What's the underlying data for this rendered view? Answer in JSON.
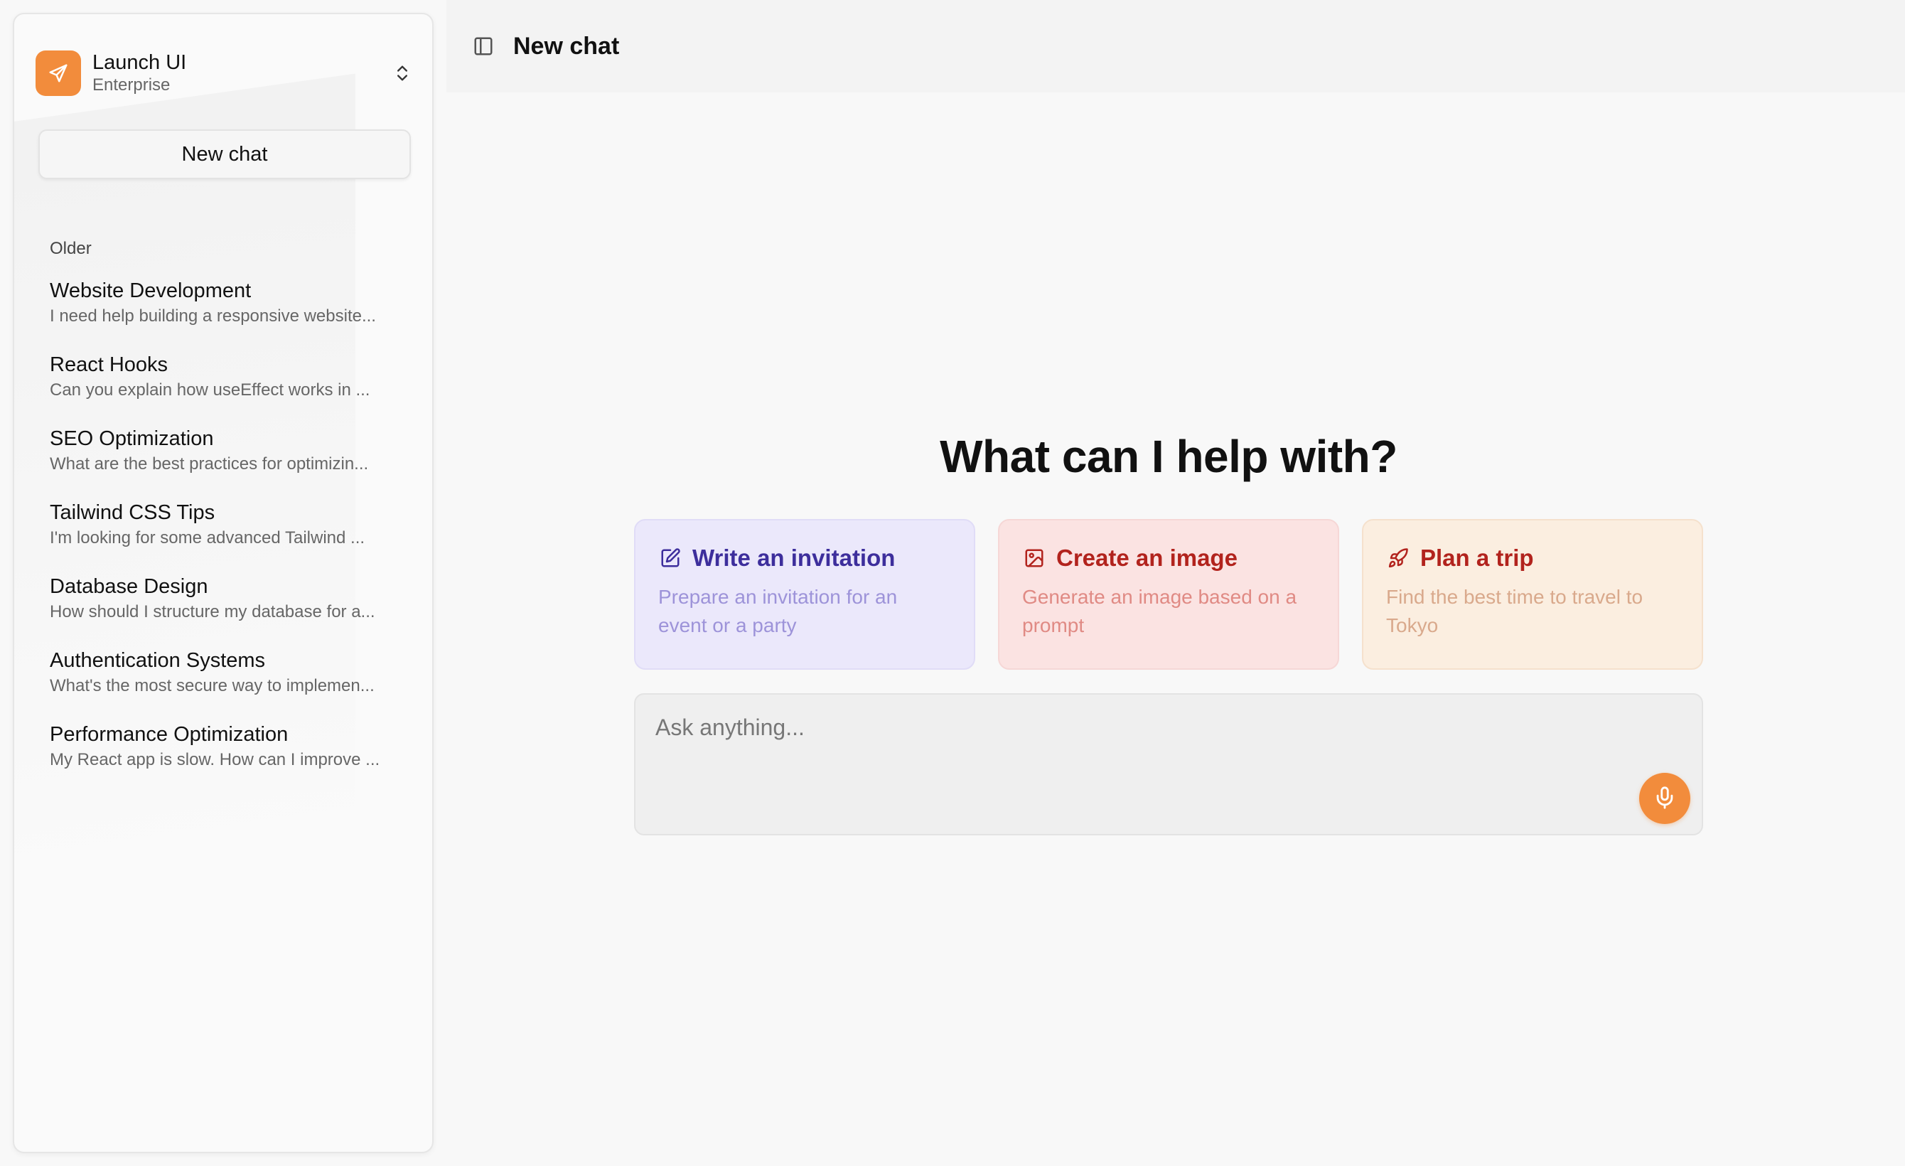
{
  "sidebar": {
    "team": {
      "name": "Launch UI",
      "plan": "Enterprise",
      "logo_icon": "paper-plane-icon",
      "switcher_icon": "chevrons-up-down-icon"
    },
    "new_chat_label": "New chat",
    "group_label": "Older",
    "items": [
      {
        "title": "Website Development",
        "preview": "I need help building a responsive website..."
      },
      {
        "title": "React Hooks",
        "preview": "Can you explain how useEffect works in ..."
      },
      {
        "title": "SEO Optimization",
        "preview": "What are the best practices for optimizin..."
      },
      {
        "title": "Tailwind CSS Tips",
        "preview": "I'm looking for some advanced Tailwind ..."
      },
      {
        "title": "Database Design",
        "preview": "How should I structure my database for a..."
      },
      {
        "title": "Authentication Systems",
        "preview": "What's the most secure way to implemen..."
      },
      {
        "title": "Performance Optimization",
        "preview": "My React app is slow. How can I improve ..."
      }
    ]
  },
  "header": {
    "toggle_icon": "panel-left-icon",
    "title": "New chat"
  },
  "main": {
    "heading": "What can I help with?",
    "suggestions": [
      {
        "icon": "edit-icon",
        "title": "Write an invitation",
        "description": "Prepare an invitation for an event or a party"
      },
      {
        "icon": "image-icon",
        "title": "Create an image",
        "description": "Generate an image based on a prompt"
      },
      {
        "icon": "rocket-icon",
        "title": "Plan a trip",
        "description": "Find the best time to travel to Tokyo"
      }
    ],
    "composer": {
      "placeholder": "Ask anything...",
      "value": "",
      "mic_icon": "microphone-icon"
    }
  },
  "colors": {
    "accent": "#f28c3c",
    "card_purple_bg": "#ebe8fb",
    "card_red_bg": "#fbe3e2",
    "card_orange_bg": "#fbeee0"
  }
}
